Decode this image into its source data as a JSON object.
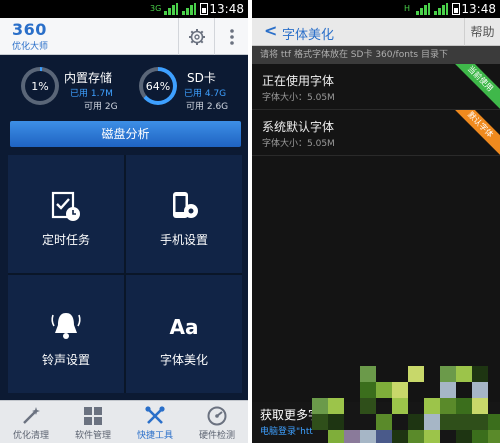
{
  "left_app": {
    "status_time": "13:48",
    "logo_main": "360",
    "logo_sub": "优化大师",
    "storage": [
      {
        "name": "内置存储",
        "percent": 1,
        "percent_label": "1%",
        "used": "已用 1.7M",
        "free": "可用 2G"
      },
      {
        "name": "SD卡",
        "percent": 64,
        "percent_label": "64%",
        "used": "已用 4.7G",
        "free": "可用 2.6G"
      }
    ],
    "disk_button": "磁盘分析",
    "tools": [
      "定时任务",
      "手机设置",
      "铃声设置",
      "字体美化"
    ],
    "nav": [
      {
        "label": "优化清理",
        "active": false
      },
      {
        "label": "软件管理",
        "active": false
      },
      {
        "label": "快捷工具",
        "active": true
      },
      {
        "label": "硬件检测",
        "active": false
      }
    ],
    "colors": {
      "accent": "#2a6fc9",
      "ring": "#3ea0ff",
      "background": "#0c1a33"
    }
  },
  "right_app": {
    "status_time": "13:48",
    "back_glyph": "<",
    "title": "字体美化",
    "help": "帮助",
    "hint": "请将 ttf 格式字体放在 SD卡 360/fonts 目录下",
    "fonts": [
      {
        "name": "正在使用字体",
        "size": "字体大小：5.05M",
        "badge": "当前使用"
      },
      {
        "name": "系统默认字体",
        "size": "字体大小：5.05M",
        "badge": "默认字体"
      }
    ],
    "get_more": "获取更多字",
    "link_text": "电脑登录\"htt",
    "colors": {
      "accent": "#2a6fc9",
      "badge_green": "#3fb84a",
      "badge_orange": "#f08a1e"
    }
  }
}
